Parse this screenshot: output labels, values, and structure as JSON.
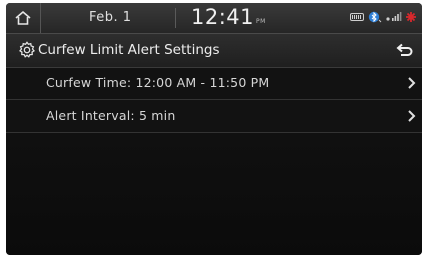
{
  "status_bar": {
    "date": "Feb.  1",
    "time": "12:41",
    "ampm": "PM"
  },
  "header": {
    "title": "Curfew Limit Alert Settings"
  },
  "settings": {
    "items": [
      {
        "label": "Curfew Time: 12:00 AM - 11:50 PM"
      },
      {
        "label": "Alert Interval: 5 min"
      }
    ]
  },
  "colors": {
    "background": "#121212",
    "text": "#e8e8e8",
    "alert_accent": "#d8282c"
  },
  "icons": {
    "home": "home-icon",
    "settings": "gear-icon",
    "back": "back-arrow-icon",
    "chevron": "chevron-right-icon",
    "usb": "usb-icon",
    "bluetooth": "bluetooth-icon",
    "signal": "signal-icon",
    "alert": "alert-icon"
  }
}
